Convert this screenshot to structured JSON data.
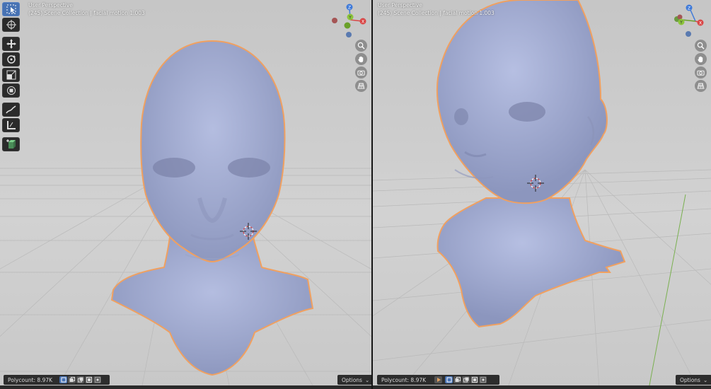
{
  "left_viewport": {
    "perspective_label": "User Perspective",
    "collection_label": "(245) Scene Collection | facial motion 1.003",
    "polycount": "Polycount: 8.97K",
    "options_label": "Options"
  },
  "right_viewport": {
    "perspective_label": "User Perspective",
    "collection_label": "(245) Scene Collection | facial motion 1.003",
    "polycount": "Polycount: 8.97K",
    "options_label": "Options"
  },
  "gizmo": {
    "x_label": "X",
    "y_label": "Y",
    "z_label": "Z"
  },
  "toolbar": [
    "select-box-icon",
    "cursor-icon",
    "move-icon",
    "rotate-icon",
    "scale-icon",
    "transform-icon",
    "annotate-icon",
    "measure-icon",
    "add-cube-icon"
  ],
  "colors": {
    "mesh": "#a6b0d0",
    "outline": "#f0a060",
    "axis_x": "#d94646",
    "axis_y": "#6aa02a",
    "axis_z": "#3f7ad9",
    "active_tool": "#4772b3"
  }
}
